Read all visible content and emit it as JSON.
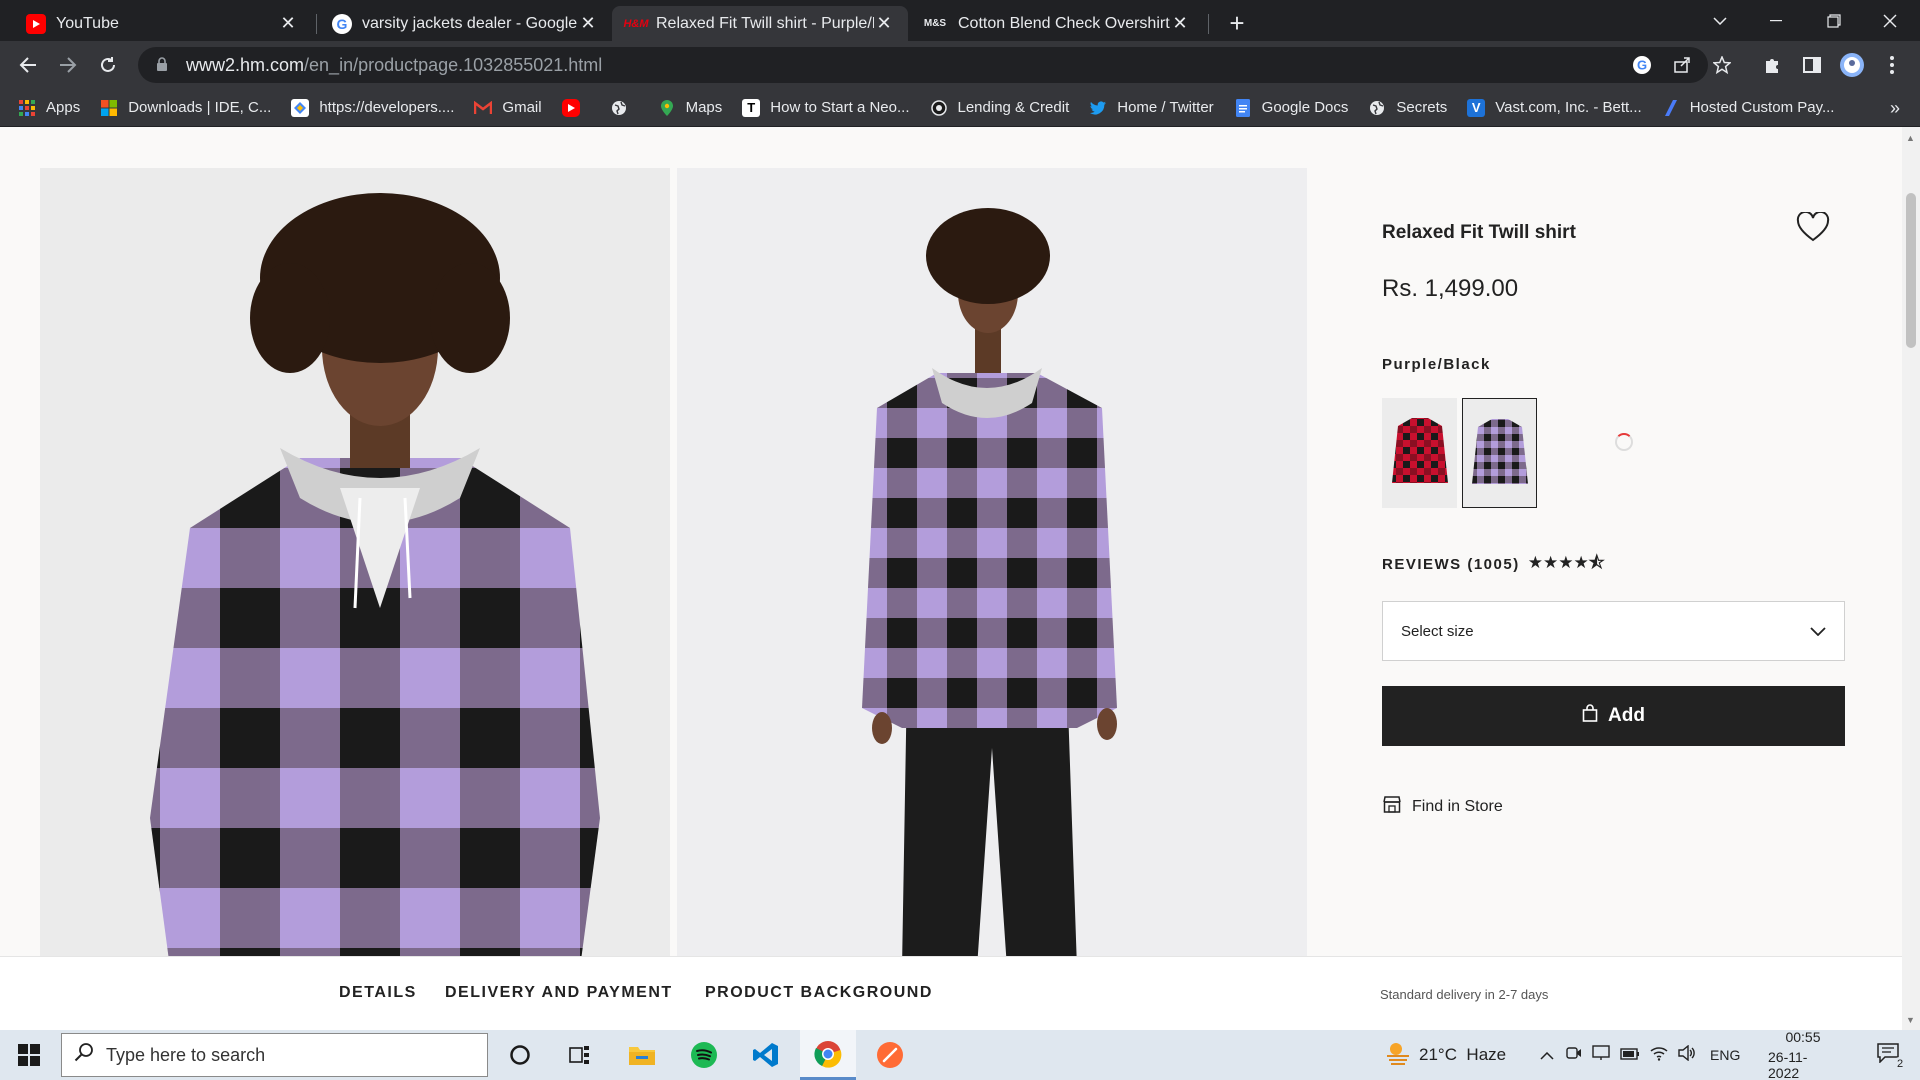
{
  "browser": {
    "tabs": [
      {
        "title": "YouTube",
        "favicon": "youtube-favicon"
      },
      {
        "title": "varsity jackets dealer - Google Se",
        "favicon": "google-favicon"
      },
      {
        "title": "Relaxed Fit Twill shirt - Purple/Bla",
        "favicon": "hm-favicon",
        "active": true
      },
      {
        "title": "Cotton Blend Check Overshirt",
        "favicon": "ms-favicon"
      }
    ],
    "favicon_text": {
      "hm": "H&M",
      "ms": "M&S"
    },
    "url_host": "www2.hm.com",
    "url_path": "/en_in/productpage.1032855021.html",
    "bookmarks": [
      {
        "label": "Apps",
        "icon": "apps-grid-icon"
      },
      {
        "label": "Downloads | IDE, C...",
        "icon": "windows-logo-icon"
      },
      {
        "label": "https://developers....",
        "icon": "cloud-icon"
      },
      {
        "label": "Gmail",
        "icon": "gmail-icon"
      },
      {
        "label": "",
        "icon": "youtube-icon"
      },
      {
        "label": "",
        "icon": "globe-icon"
      },
      {
        "label": "Maps",
        "icon": "maps-pin-icon"
      },
      {
        "label": "How to Start a Neo...",
        "icon": "t-icon"
      },
      {
        "label": "Lending & Credit",
        "icon": "circle-icon"
      },
      {
        "label": "Home / Twitter",
        "icon": "twitter-icon"
      },
      {
        "label": "Google Docs",
        "icon": "docs-icon"
      },
      {
        "label": "Secrets",
        "icon": "globe-icon"
      },
      {
        "label": "Vast.com, Inc. - Bett...",
        "icon": "v-icon"
      },
      {
        "label": "Hosted Custom Pay...",
        "icon": "slash-icon"
      }
    ]
  },
  "product": {
    "title": "Relaxed Fit Twill shirt",
    "price": "Rs. 1,499.00",
    "color_name": "Purple/Black",
    "reviews_label": "REVIEWS (1005)",
    "rating": 4.5,
    "stars_display": "★★★★⯪",
    "size_select_label": "Select size",
    "add_label": "Add",
    "find_in_store": "Find in Store"
  },
  "detail_tabs": [
    "DETAILS",
    "DELIVERY AND PAYMENT",
    "PRODUCT BACKGROUND"
  ],
  "delivery_note": "Standard delivery in 2-7 days",
  "taskbar": {
    "search_placeholder": "Type here to search",
    "weather": "21°C  Haze",
    "lang": "ENG",
    "time": "00:55",
    "date": "26-11-2022",
    "notifications": "2"
  },
  "colors": {
    "accent_dark": "#222222",
    "lavender": "#b39ddb",
    "check_red": "#c8102e"
  }
}
